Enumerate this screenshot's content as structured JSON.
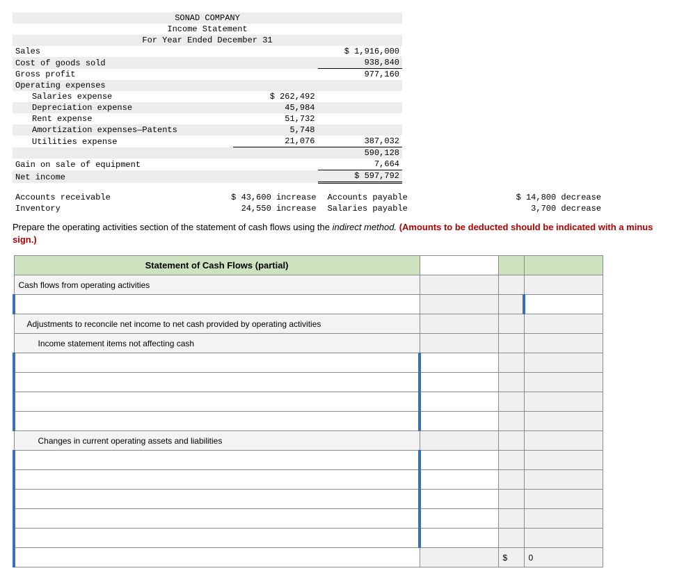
{
  "income_statement": {
    "company": "SONAD COMPANY",
    "title": "Income Statement",
    "period": "For Year Ended December 31",
    "rows": {
      "sales_lbl": "Sales",
      "sales_val": "$ 1,916,000",
      "cogs_lbl": "Cost of goods sold",
      "cogs_val": "938,840",
      "gp_lbl": "Gross profit",
      "gp_val": "977,160",
      "opex_lbl": "Operating expenses",
      "sal_lbl": "Salaries expense",
      "sal_val": "$ 262,492",
      "dep_lbl": "Depreciation expense",
      "dep_val": "45,984",
      "rent_lbl": "Rent expense",
      "rent_val": "51,732",
      "amort_lbl": "Amortization expenses—Patents",
      "amort_val": "5,748",
      "util_lbl": "Utilities expense",
      "util_val": "21,076",
      "opex_total": "387,032",
      "op_income": "590,128",
      "gain_lbl": "Gain on sale of equipment",
      "gain_val": "7,664",
      "ni_lbl": "Net income",
      "ni_val": "$ 597,792"
    }
  },
  "changes": {
    "ar_lbl": "Accounts receivable",
    "ar_val": "$ 43,600 increase",
    "inv_lbl": "Inventory",
    "inv_val": "24,550 increase",
    "ap_lbl": "Accounts payable",
    "ap_val": "$ 14,800 decrease",
    "sp_lbl": "Salaries payable",
    "sp_val": "3,700 decrease"
  },
  "instructions": {
    "part1": "Prepare the operating activities section of the statement of cash flows using the ",
    "method": "indirect method.",
    "part2": " (Amounts to be deducted should be indicated with a minus sign.)"
  },
  "answer": {
    "title": "Statement of Cash Flows (partial)",
    "cfo": "Cash flows from operating activities",
    "adj": "Adjustments to reconcile net income to net cash provided by operating activities",
    "is_items": "Income statement items not affecting cash",
    "changes_hdr": "Changes in current operating assets and liabilities",
    "dollar": "$",
    "zero": "0"
  }
}
